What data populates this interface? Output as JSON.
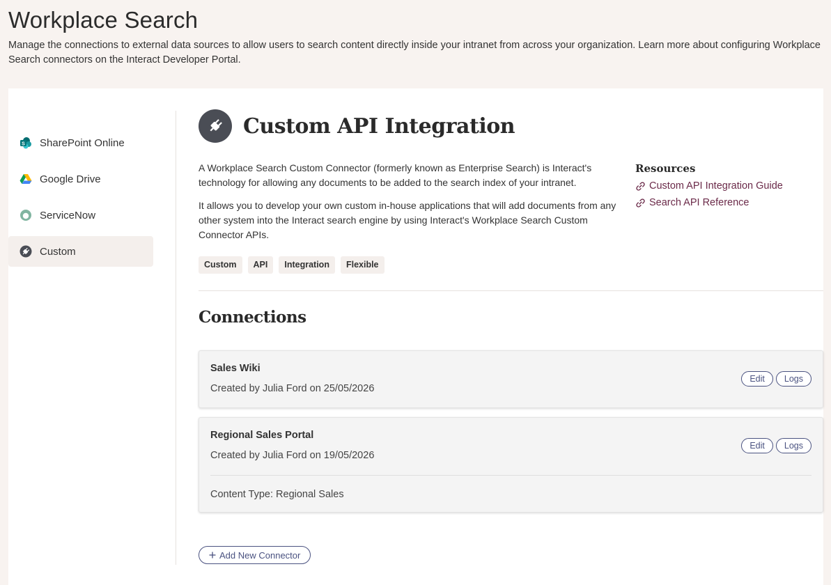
{
  "page": {
    "title": "Workplace Search",
    "description": "Manage the connections to external data sources to allow users to search content directly inside your intranet from across your organization. Learn more about configuring Workplace Search connectors on the Interact Developer Portal."
  },
  "sidebar": {
    "items": [
      {
        "label": "SharePoint Online",
        "icon": "sharepoint-icon",
        "active": false
      },
      {
        "label": "Google Drive",
        "icon": "google-drive-icon",
        "active": false
      },
      {
        "label": "ServiceNow",
        "icon": "servicenow-icon",
        "active": false
      },
      {
        "label": "Custom",
        "icon": "plug-icon",
        "active": true
      }
    ]
  },
  "connector": {
    "title": "Custom API Integration",
    "icon": "plug-icon",
    "intro": [
      "A Workplace Search Custom Connector (formerly known as Enterprise Search) is Interact's technology for allowing any documents to be added to the search index of your intranet.",
      "It allows you to develop your own custom in-house applications that will add documents from any other system into the Interact search engine by using Interact's Workplace Search Custom Connector APIs."
    ],
    "tags": [
      "Custom",
      "API",
      "Integration",
      "Flexible"
    ],
    "resources": {
      "title": "Resources",
      "links": [
        "Custom API Integration Guide",
        "Search API Reference"
      ]
    }
  },
  "connections": {
    "title": "Connections",
    "items": [
      {
        "name": "Sales Wiki",
        "meta": "Created by Julia Ford on 25/05/2026",
        "edit": "Edit",
        "logs": "Logs"
      },
      {
        "name": "Regional Sales Portal",
        "meta": "Created by Julia Ford on 19/05/2026",
        "extra": "Content Type: Regional Sales",
        "edit": "Edit",
        "logs": "Logs"
      }
    ],
    "add_label": "Add New Connector"
  },
  "colors": {
    "background": "#f8f3f0",
    "link": "#6b2a49",
    "button_outline": "#4a5280",
    "icon_dark": "#4a4d55"
  }
}
